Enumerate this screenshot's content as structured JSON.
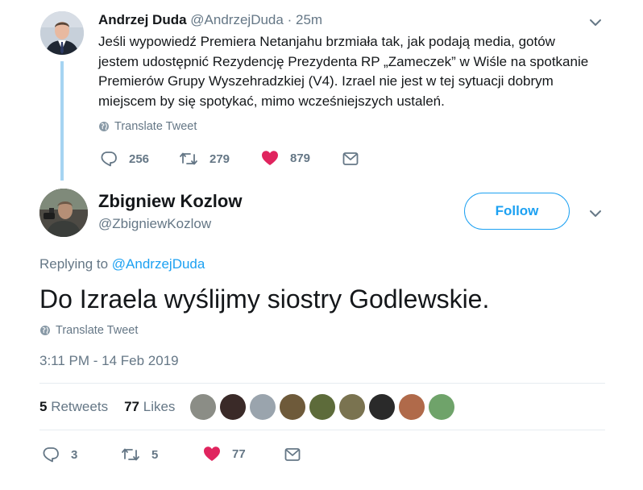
{
  "parent_tweet": {
    "name": "Andrzej Duda",
    "handle": "@AndrzejDuda",
    "separator": "·",
    "time": "25m",
    "text": "Jeśli wypowiedź Premiera Netanjahu brzmiała tak, jak podają media, gotów jestem udostępnić Rezydencję Prezydenta RP „Zameczek” w Wiśle na spotkanie Premierów Grupy Wyszehradzkiej (V4). Izrael nie jest w tej sytuacji dobrym miejscem by się spotykać, mimo wcześniejszych ustaleń.",
    "translate_label": "Translate Tweet",
    "reply_count": "256",
    "retweet_count": "279",
    "like_count": "879"
  },
  "reply_tweet": {
    "name": "Zbigniew Kozlow",
    "handle": "@ZbigniewKozlow",
    "follow_label": "Follow",
    "replying_label": "Replying to",
    "replying_to": "@AndrzejDuda",
    "text": "Do Izraela wyślijmy siostry Godlewskie.",
    "translate_label": "Translate Tweet",
    "timestamp": "3:11 PM - 14 Feb 2019",
    "retweets_count": "5",
    "retweets_label": "Retweets",
    "likes_count": "77",
    "likes_label": "Likes",
    "reply_count": "3",
    "retweet_count": "5",
    "like_count": "77"
  },
  "liker_avatars": [
    {
      "icon": "liker-avatar-1-icon",
      "color": "#8b8d86"
    },
    {
      "icon": "liker-avatar-2-icon",
      "color": "#3a2a28"
    },
    {
      "icon": "liker-avatar-3-icon",
      "color": "#9aa4ad"
    },
    {
      "icon": "liker-avatar-4-icon",
      "color": "#6e5a3a"
    },
    {
      "icon": "liker-avatar-5-icon",
      "color": "#5d6b3a"
    },
    {
      "icon": "liker-avatar-6-icon",
      "color": "#7a7350"
    },
    {
      "icon": "liker-avatar-7-icon",
      "color": "#2a2a2a"
    },
    {
      "icon": "liker-avatar-8-icon",
      "color": "#b06a4a"
    },
    {
      "icon": "liker-avatar-9-icon",
      "color": "#6fa36a"
    }
  ],
  "colors": {
    "accent": "#1da1f2",
    "like": "#e0245e",
    "muted": "#657786",
    "thread_line": "#a6d4f2"
  }
}
